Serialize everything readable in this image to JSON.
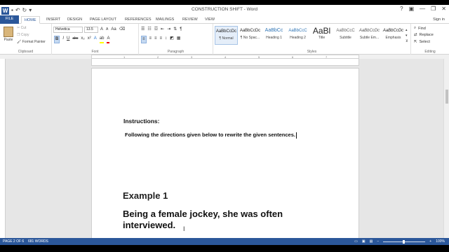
{
  "window": {
    "title": "CONSTRUCTION SHIFT - Word",
    "controls": [
      "?",
      "▣",
      "—",
      "❐",
      "✕"
    ],
    "signin": "Sign in"
  },
  "qat": {
    "logo": "W"
  },
  "tabs": [
    "FILE",
    "HOME",
    "INSERT",
    "DESIGN",
    "PAGE LAYOUT",
    "REFERENCES",
    "MAILINGS",
    "REVIEW",
    "VIEW"
  ],
  "active_tab": "HOME",
  "ribbon": {
    "clipboard": {
      "paste": "Paste",
      "cut": "Cut",
      "copy": "Copy",
      "format_painter": "Format Painter",
      "label": "Clipboard"
    },
    "font": {
      "name": "Helvetica",
      "size": "13.5",
      "label": "Font",
      "grow": "A",
      "shrink": "A",
      "case": "Aa",
      "bold": "B",
      "italic": "I",
      "underline": "U",
      "strike": "abc",
      "sub": "x₂",
      "sup": "x²"
    },
    "paragraph": {
      "label": "Paragraph",
      "pilcrow": "¶"
    },
    "styles": {
      "label": "Styles",
      "items": [
        {
          "sample": "AaBbCcDc",
          "name": "¶ Normal"
        },
        {
          "sample": "AaBbCcDc",
          "name": "¶ No Spac..."
        },
        {
          "sample": "AaBbCc",
          "name": "Heading 1"
        },
        {
          "sample": "AaBbCcC",
          "name": "Heading 2"
        },
        {
          "sample": "AaBl",
          "name": "Title"
        },
        {
          "sample": "AaBbCcC",
          "name": "Subtitle"
        },
        {
          "sample": "AaBbCcDc",
          "name": "Subtle Em..."
        },
        {
          "sample": "AaBbCcDc",
          "name": "Emphasis"
        }
      ]
    },
    "editing": {
      "find": "Find",
      "replace": "Replace",
      "select": "Select",
      "label": "Editing"
    }
  },
  "ruler": {
    "ticks": [
      "1",
      "2",
      "3",
      "4",
      "5",
      "6",
      "7"
    ]
  },
  "document": {
    "instructions_heading": "Instructions:",
    "instructions_text": "Following the directions given below to rewrite the given sentences.",
    "example_heading": "Example 1",
    "example_text": "Being a female jockey, she was often interviewed."
  },
  "status": {
    "page": "PAGE 2 OF 6",
    "words": "681 WORDS",
    "zoom": "100%"
  },
  "colors": {
    "accent": "#2b579a"
  }
}
